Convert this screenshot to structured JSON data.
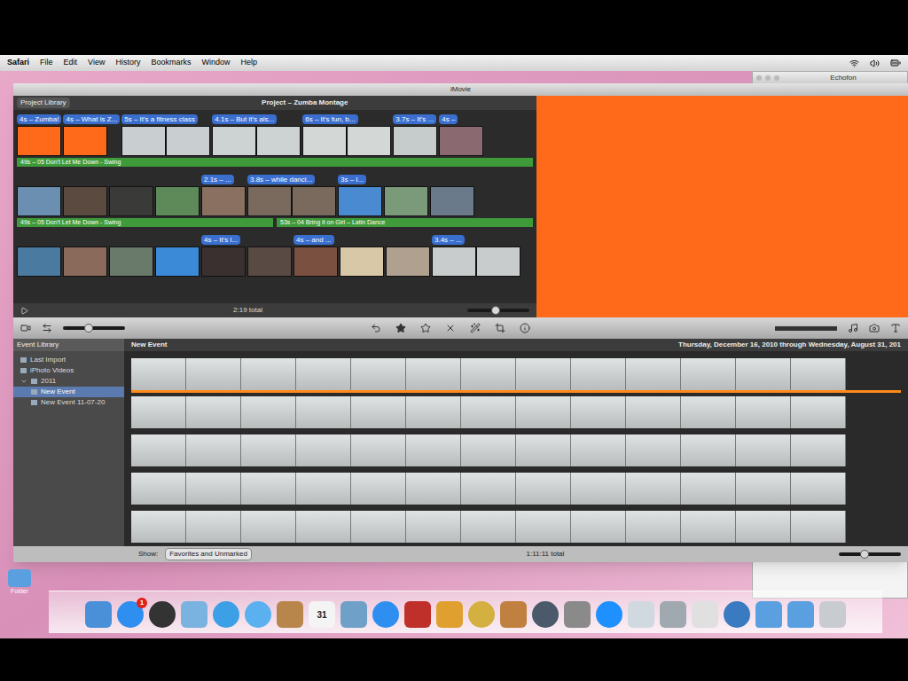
{
  "menubar": {
    "items": [
      {
        "label": "Safari",
        "bold": true
      },
      {
        "label": "File",
        "bold": false
      },
      {
        "label": "Edit",
        "bold": false
      },
      {
        "label": "View",
        "bold": false
      },
      {
        "label": "History",
        "bold": false
      },
      {
        "label": "Bookmarks",
        "bold": false
      },
      {
        "label": "Window",
        "bold": false
      },
      {
        "label": "Help",
        "bold": false
      }
    ]
  },
  "echofon": {
    "title": "Echofon"
  },
  "window": {
    "title": "iMovie"
  },
  "project": {
    "library_button": "Project Library",
    "title": "Project – Zumba Montage",
    "total": "2:19 total",
    "zoom_level": 0.45,
    "rows": [
      {
        "clips": [
          {
            "label": "4s – Zumba!",
            "frames": 1,
            "color": "#ff6a1a"
          },
          {
            "label": "4s – What is Z...",
            "frames": 1,
            "color": "#ff6a1a"
          },
          {
            "label": "5s – It's a fitness class",
            "frames": 2,
            "color": "#c9cfd0"
          },
          {
            "label": "4.1s – But it's als...",
            "frames": 2,
            "color": "#cdd2d2"
          },
          {
            "label": "6s – It's fun, b...",
            "frames": 2,
            "color": "#d3d7d6"
          },
          {
            "label": "3.7s – It's ...",
            "frames": 1,
            "color": "#c6cccc"
          },
          {
            "label": "4s –",
            "frames": 1,
            "color": "#8a6a70"
          }
        ],
        "music": [
          "49s – 05 Don't Let Me Down - Swing"
        ]
      },
      {
        "clips": [
          {
            "label": "",
            "frames": 1,
            "color": "#6a8fb0"
          },
          {
            "label": "",
            "frames": 1,
            "color": "#5a4a40"
          },
          {
            "label": "",
            "frames": 1,
            "color": "#3a3a38"
          },
          {
            "label": "",
            "frames": 1,
            "color": "#5e8a5a"
          },
          {
            "label": "2.1s – ...",
            "frames": 1,
            "color": "#8a7060"
          },
          {
            "label": "3.8s – while danci...",
            "frames": 2,
            "color": "#7a6a5e"
          },
          {
            "label": "3s – I...",
            "frames": 1,
            "color": "#4a8ad0"
          },
          {
            "label": "",
            "frames": 1,
            "color": "#7a9a7a"
          },
          {
            "label": "",
            "frames": 1,
            "color": "#6a7a8a"
          }
        ],
        "music": [
          "49s – 05 Don't Let Me Down - Swing",
          "53s – 04 Bring it on Girl – Latin Dance"
        ]
      },
      {
        "clips": [
          {
            "label": "",
            "frames": 1,
            "color": "#4a7aa0"
          },
          {
            "label": "",
            "frames": 1,
            "color": "#8a6a5a"
          },
          {
            "label": "",
            "frames": 1,
            "color": "#6a7a6a"
          },
          {
            "label": "",
            "frames": 1,
            "color": "#3a8ad8"
          },
          {
            "label": "4s – It's l...",
            "frames": 1,
            "color": "#3a3030"
          },
          {
            "label": "",
            "frames": 1,
            "color": "#5a4a44"
          },
          {
            "label": "4s – and ...",
            "frames": 1,
            "color": "#7a5040"
          },
          {
            "label": "",
            "frames": 1,
            "color": "#d8c8a8"
          },
          {
            "label": "",
            "frames": 1,
            "color": "#b0a090"
          },
          {
            "label": "3.4s – ...",
            "frames": 2,
            "color": "#c8cccc"
          }
        ],
        "music": []
      }
    ]
  },
  "event_library": {
    "title": "Event Library",
    "items": [
      {
        "label": "Last Import",
        "kind": "item",
        "selected": false
      },
      {
        "label": "iPhoto Videos",
        "kind": "item",
        "selected": false
      },
      {
        "label": "2011",
        "kind": "year",
        "selected": false,
        "expanded": true
      },
      {
        "label": "New Event",
        "kind": "event",
        "selected": true
      },
      {
        "label": "New Event 11-07-20",
        "kind": "event",
        "selected": false
      }
    ]
  },
  "event": {
    "title": "New Event",
    "dates": "Thursday, December 16, 2010 through Wednesday, August 31, 201",
    "rows": [
      {
        "frames": 13,
        "selected": true
      },
      {
        "frames": 13,
        "selected": false
      },
      {
        "frames": 13,
        "selected": false
      },
      {
        "frames": 13,
        "selected": false
      },
      {
        "frames": 13,
        "selected": false
      }
    ]
  },
  "browser_bar": {
    "show_label": "Show:",
    "filter": "Favorites and Unmarked",
    "total": "1:11:11 total",
    "zoom_level": 0.4
  },
  "desktop": {
    "icons": [
      {
        "label": "Folder",
        "color": "#5aa0e0"
      }
    ]
  },
  "dock": {
    "items": [
      {
        "kind": "square",
        "color": "#4a90d9",
        "text": "",
        "badge": ""
      },
      {
        "kind": "round",
        "color": "#2f8ff0",
        "text": "",
        "badge": "1"
      },
      {
        "kind": "round",
        "color": "#333333",
        "text": "",
        "badge": ""
      },
      {
        "kind": "square",
        "color": "#7ab2e0",
        "text": "",
        "badge": ""
      },
      {
        "kind": "round",
        "color": "#3da0e6",
        "text": "",
        "badge": ""
      },
      {
        "kind": "round",
        "color": "#5bb0f0",
        "text": "",
        "badge": ""
      },
      {
        "kind": "square",
        "color": "#b8864b",
        "text": "",
        "badge": ""
      },
      {
        "kind": "square",
        "color": "#f4f4f4",
        "text": "31",
        "badge": ""
      },
      {
        "kind": "square",
        "color": "#6fa0c8",
        "text": "",
        "badge": ""
      },
      {
        "kind": "round",
        "color": "#2f8ff0",
        "text": "",
        "badge": ""
      },
      {
        "kind": "square",
        "color": "#c0302a",
        "text": "",
        "badge": ""
      },
      {
        "kind": "square",
        "color": "#e0a030",
        "text": "",
        "badge": ""
      },
      {
        "kind": "round",
        "color": "#d4b040",
        "text": "",
        "badge": ""
      },
      {
        "kind": "square",
        "color": "#c08040",
        "text": "",
        "badge": ""
      },
      {
        "kind": "round",
        "color": "#4a5a6a",
        "text": "",
        "badge": ""
      },
      {
        "kind": "square",
        "color": "#8a8a8a",
        "text": "",
        "badge": ""
      },
      {
        "kind": "round",
        "color": "#1e90ff",
        "text": "",
        "badge": ""
      },
      {
        "kind": "square",
        "color": "#d0d8e0",
        "text": "",
        "badge": ""
      },
      {
        "kind": "square",
        "color": "#a0a8b0",
        "text": "",
        "badge": ""
      },
      {
        "kind": "square",
        "color": "#e0e0e0",
        "text": "",
        "badge": ""
      },
      {
        "kind": "round",
        "color": "#3a7ac0",
        "text": "",
        "badge": ""
      },
      {
        "kind": "folder",
        "color": "#5aa0e0",
        "text": "",
        "badge": ""
      },
      {
        "kind": "folder",
        "color": "#5aa0e0",
        "text": "",
        "badge": ""
      },
      {
        "kind": "square",
        "color": "#c8ccd0",
        "text": "",
        "badge": ""
      }
    ]
  }
}
